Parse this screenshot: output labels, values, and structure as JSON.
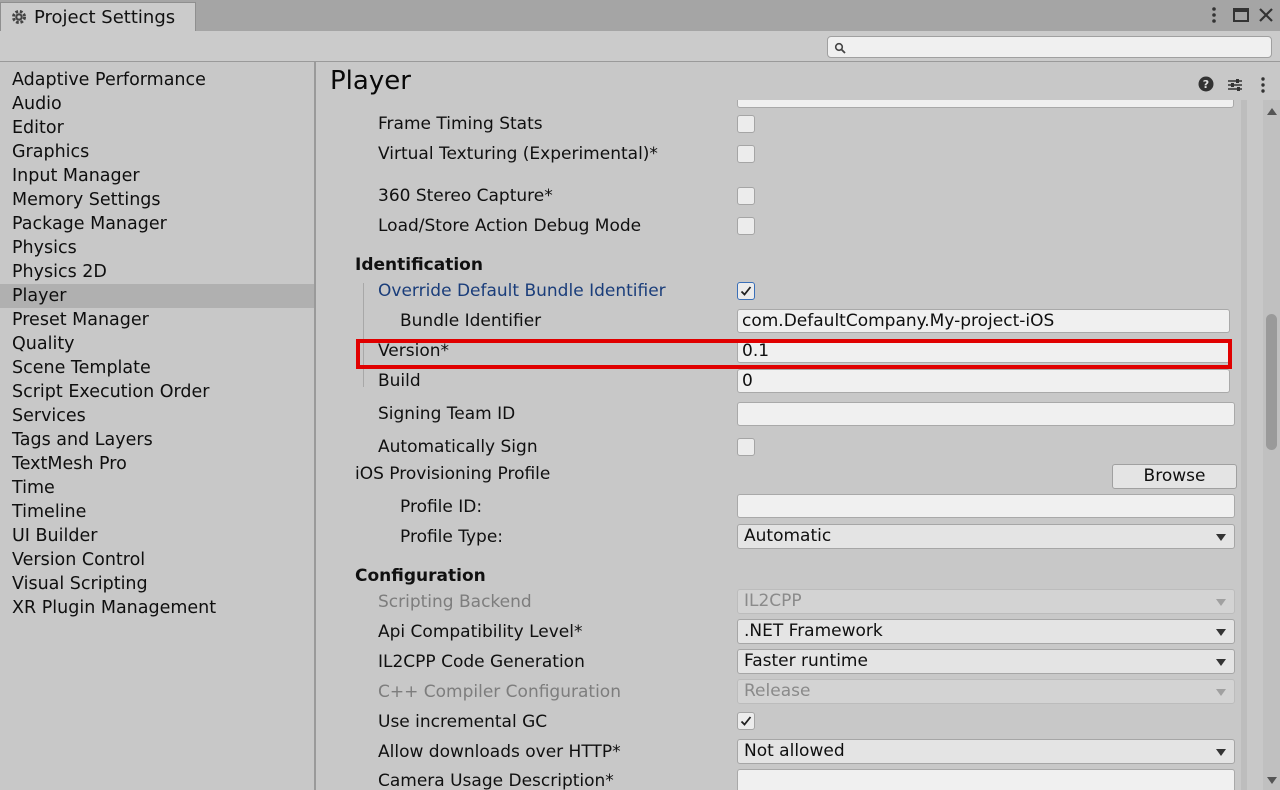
{
  "window": {
    "tab_title": "Project Settings"
  },
  "search": {
    "placeholder": "",
    "value": ""
  },
  "sidebar": {
    "items": [
      {
        "label": "Adaptive Performance"
      },
      {
        "label": "Audio"
      },
      {
        "label": "Editor"
      },
      {
        "label": "Graphics"
      },
      {
        "label": "Input Manager"
      },
      {
        "label": "Memory Settings"
      },
      {
        "label": "Package Manager"
      },
      {
        "label": "Physics"
      },
      {
        "label": "Physics 2D"
      },
      {
        "label": "Player"
      },
      {
        "label": "Preset Manager"
      },
      {
        "label": "Quality"
      },
      {
        "label": "Scene Template"
      },
      {
        "label": "Script Execution Order"
      },
      {
        "label": "Services"
      },
      {
        "label": "Tags and Layers"
      },
      {
        "label": "TextMesh Pro"
      },
      {
        "label": "Time"
      },
      {
        "label": "Timeline"
      },
      {
        "label": "UI Builder"
      },
      {
        "label": "Version Control"
      },
      {
        "label": "Visual Scripting"
      },
      {
        "label": "XR Plugin Management"
      }
    ],
    "selected": "Player"
  },
  "main": {
    "title": "Player",
    "rows": {
      "frame_timing": {
        "label": "Frame Timing Stats",
        "checked": false
      },
      "virtual_texturing": {
        "label": "Virtual Texturing (Experimental)*",
        "checked": false
      },
      "stereo_capture": {
        "label": "360 Stereo Capture*",
        "checked": false
      },
      "load_store": {
        "label": "Load/Store Action Debug Mode",
        "checked": false
      }
    },
    "identification": {
      "heading": "Identification",
      "override_label": "Override Default Bundle Identifier",
      "override_checked": true,
      "bundle_label": "Bundle Identifier",
      "bundle_value": "com.DefaultCompany.My-project-iOS",
      "version_label": "Version*",
      "version_value": "0.1",
      "build_label": "Build",
      "build_value": "0",
      "signing_label": "Signing Team ID",
      "signing_value": "",
      "auto_sign_label": "Automatically Sign",
      "auto_sign_checked": false,
      "provisioning_label": "iOS Provisioning Profile",
      "browse_label": "Browse",
      "profile_id_label": "Profile ID:",
      "profile_id_value": "",
      "profile_type_label": "Profile Type:",
      "profile_type_value": "Automatic"
    },
    "configuration": {
      "heading": "Configuration",
      "scripting_backend_label": "Scripting Backend",
      "scripting_backend_value": "IL2CPP",
      "api_label": "Api Compatibility Level*",
      "api_value": ".NET Framework",
      "il2cpp_label": "IL2CPP Code Generation",
      "il2cpp_value": "Faster runtime",
      "cpp_label": "C++ Compiler Configuration",
      "cpp_value": "Release",
      "gc_label": "Use incremental GC",
      "gc_checked": true,
      "http_label": "Allow downloads over HTTP*",
      "http_value": "Not allowed",
      "camera_label": "Camera Usage Description*",
      "camera_value": ""
    }
  },
  "colors": {
    "highlight": "#e00000",
    "link": "#1a3d7a",
    "selected_row": "#b0b0b0"
  }
}
